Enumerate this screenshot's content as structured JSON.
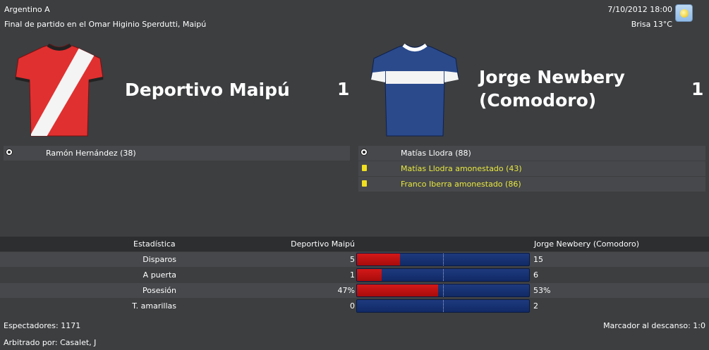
{
  "header": {
    "competition": "Argentino A",
    "subtitle": "Final de partido en el Omar Higinio Sperdutti, Maipú",
    "datetime": "7/10/2012 18:00",
    "weather": "Brisa 13°C",
    "weather_icon": "sunny-weather-icon"
  },
  "home": {
    "name": "Deportivo Maipú",
    "score": "1",
    "shirt_colors": {
      "body": "#e03030",
      "sash": "#ffffff",
      "trim": "#222222"
    },
    "events": [
      {
        "type": "goal",
        "icon": "soccer-ball-icon",
        "text": "Ramón Hernández (38)"
      }
    ]
  },
  "away": {
    "name_line1": "Jorge Newbery",
    "name_line2": "(Comodoro)",
    "score": "1",
    "shirt_colors": {
      "body": "#2a4a8c",
      "band": "#ffffff",
      "trim": "#ffffff"
    },
    "events": [
      {
        "type": "goal",
        "icon": "soccer-ball-icon",
        "text": "Matías Llodra (88)"
      },
      {
        "type": "card",
        "icon": "yellow-card-icon",
        "text": "Matías Llodra amonestado (43)"
      },
      {
        "type": "card",
        "icon": "yellow-card-icon",
        "text": "Franco Iberra amonestado (86)"
      }
    ]
  },
  "stats": {
    "header": {
      "label": "Estadística",
      "home": "Deportivo Maipú",
      "away": "Jorge Newbery (Comodoro)"
    },
    "rows": [
      {
        "label": "Disparos",
        "home": "5",
        "away": "15",
        "home_share": 0.25
      },
      {
        "label": "A puerta",
        "home": "1",
        "away": "6",
        "home_share": 0.143
      },
      {
        "label": "Posesión",
        "home": "47%",
        "away": "53%",
        "home_share": 0.47
      },
      {
        "label": "T. amarillas",
        "home": "0",
        "away": "2",
        "home_share": 0.0
      }
    ],
    "colors": {
      "home": "#c81010",
      "away": "#15306e"
    }
  },
  "footer": {
    "attendance": "Espectadores: 1171",
    "halftime": "Marcador al descanso: 1:0",
    "referee": "Arbitrado por: Casalet, J"
  }
}
